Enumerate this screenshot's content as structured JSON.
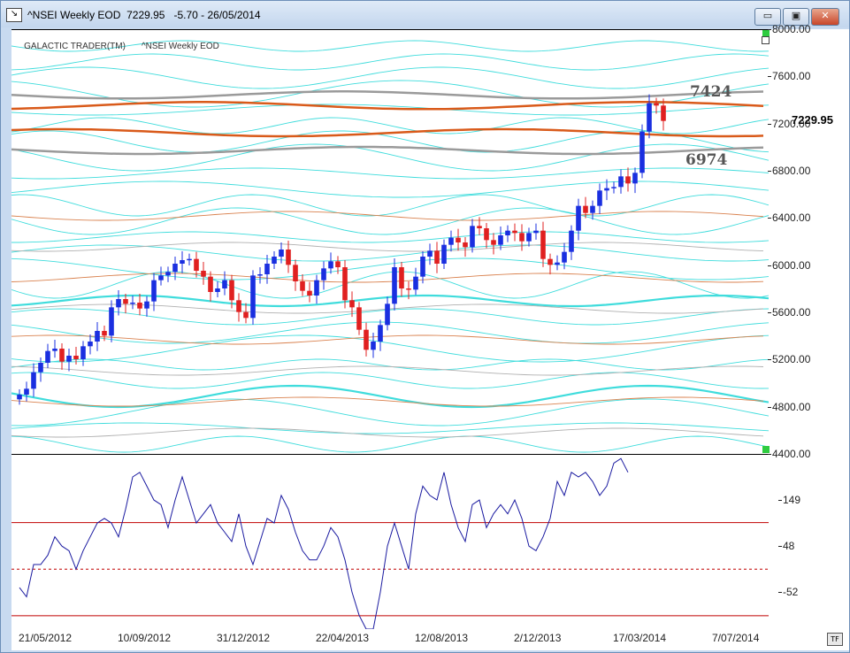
{
  "window": {
    "title": "^NSEI Weekly EOD  7229.95   -5.70 - 26/05/2014",
    "icon": "chart-icon",
    "minimize": "▭",
    "maximize": "▣",
    "close": "✕"
  },
  "legend": {
    "left": "GALACTIC TRADER(TM)",
    "right": "^NSEI Weekly EOD"
  },
  "levels": {
    "upper": "7424",
    "lower": "6974"
  },
  "last_price": "7229.95",
  "corner_badge": "TF",
  "chart_data": [
    {
      "type": "candlestick",
      "y_ticks": [
        "8000.00",
        "7600.00",
        "7200.00",
        "6800.00",
        "6400.00",
        "6000.00",
        "5600.00",
        "5200.00",
        "4800.00",
        "4400.00"
      ],
      "ylim": [
        4400,
        8000
      ],
      "x_ticks": [
        "21/05/2012",
        "10/09/2012",
        "31/12/2012",
        "22/04/2013",
        "12/08/2013",
        "2/12/2013",
        "17/03/2014",
        "7/07/2014"
      ],
      "close": [
        4910,
        4960,
        5100,
        5180,
        5280,
        5300,
        5190,
        5240,
        5210,
        5320,
        5360,
        5450,
        5410,
        5650,
        5720,
        5680,
        5690,
        5640,
        5700,
        5880,
        5920,
        5950,
        6020,
        6050,
        6060,
        5960,
        5910,
        5780,
        5810,
        5880,
        5710,
        5610,
        5560,
        5920,
        5930,
        6020,
        6080,
        6140,
        6010,
        5870,
        5790,
        5750,
        5880,
        5980,
        6040,
        5990,
        5710,
        5650,
        5460,
        5290,
        5360,
        5500,
        5680,
        5990,
        5810,
        5800,
        5910,
        6080,
        6130,
        6020,
        6180,
        6240,
        6200,
        6160,
        6340,
        6320,
        6220,
        6180,
        6260,
        6300,
        6280,
        6210,
        6280,
        6300,
        6060,
        6010,
        6030,
        6120,
        6300,
        6510,
        6450,
        6510,
        6640,
        6660,
        6670,
        6760,
        6700,
        6790,
        7140,
        7380,
        7360,
        7229.95
      ],
      "level_lines": [
        {
          "value": 7450,
          "color": "#9a9a9a"
        },
        {
          "value": 7360,
          "color": "#d95a1a"
        },
        {
          "value": 7130,
          "color": "#d95a1a"
        },
        {
          "value": 6980,
          "color": "#9a9a9a"
        }
      ]
    },
    {
      "type": "line",
      "y_ticks": [
        "149",
        "48",
        "-52"
      ],
      "ylim": [
        -132,
        248
      ],
      "reference_lines": [
        101,
        0,
        -101
      ],
      "values": [
        -40,
        -60,
        10,
        10,
        30,
        70,
        50,
        40,
        0,
        40,
        70,
        100,
        110,
        100,
        70,
        130,
        200,
        210,
        180,
        150,
        140,
        90,
        150,
        200,
        150,
        100,
        120,
        140,
        100,
        80,
        60,
        120,
        50,
        10,
        60,
        110,
        100,
        160,
        130,
        80,
        40,
        20,
        20,
        50,
        90,
        70,
        20,
        -50,
        -100,
        -130,
        -130,
        -50,
        50,
        100,
        50,
        0,
        120,
        180,
        160,
        150,
        210,
        140,
        90,
        60,
        140,
        150,
        90,
        120,
        140,
        120,
        150,
        110,
        50,
        40,
        70,
        110,
        190,
        160,
        210,
        200,
        210,
        190,
        160,
        180,
        230,
        240,
        210
      ]
    }
  ]
}
